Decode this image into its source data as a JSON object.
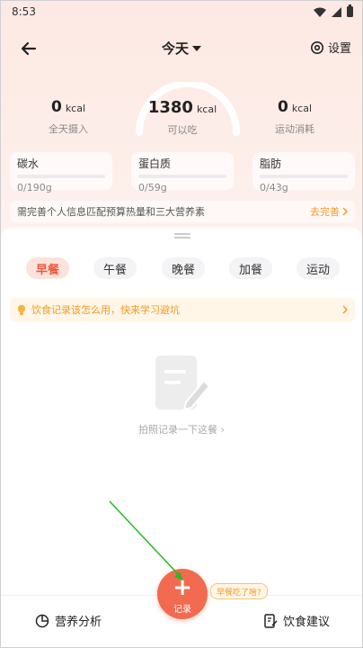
{
  "status_bar": {
    "time": "8:53"
  },
  "header": {
    "date_label": "今天",
    "settings_label": "设置"
  },
  "calories": {
    "intake": {
      "value": "0",
      "unit": "kcal",
      "label": "全天摄入"
    },
    "remaining": {
      "value": "1380",
      "unit": "kcal",
      "label": "可以吃"
    },
    "burned": {
      "value": "0",
      "unit": "kcal",
      "label": "运动消耗"
    }
  },
  "macros": [
    {
      "name": "碳水",
      "amount": "0/190g",
      "progress": 0
    },
    {
      "name": "蛋白质",
      "amount": "0/59g",
      "progress": 0
    },
    {
      "name": "脂肪",
      "amount": "0/43g",
      "progress": 0
    }
  ],
  "profile_hint": {
    "text": "需完善个人信息匹配预算热量和三大营养素",
    "link": "去完善"
  },
  "meal_tabs": [
    {
      "label": "早餐",
      "active": true
    },
    {
      "label": "午餐",
      "active": false
    },
    {
      "label": "晚餐",
      "active": false
    },
    {
      "label": "加餐",
      "active": false
    },
    {
      "label": "运动",
      "active": false
    }
  ],
  "tip_banner": {
    "text": "饮食记录该怎么用，快来学习避坑"
  },
  "empty_state": {
    "text": "拍照记录一下这餐"
  },
  "bottom_bar": {
    "left_label": "营养分析",
    "record_label": "记录",
    "record_bubble": "早餐吃了啥?",
    "right_label": "饮食建议"
  },
  "colors": {
    "accent": "#f26a4f",
    "tip": "#f39a26",
    "annotation_arrow": "#22bb22"
  }
}
